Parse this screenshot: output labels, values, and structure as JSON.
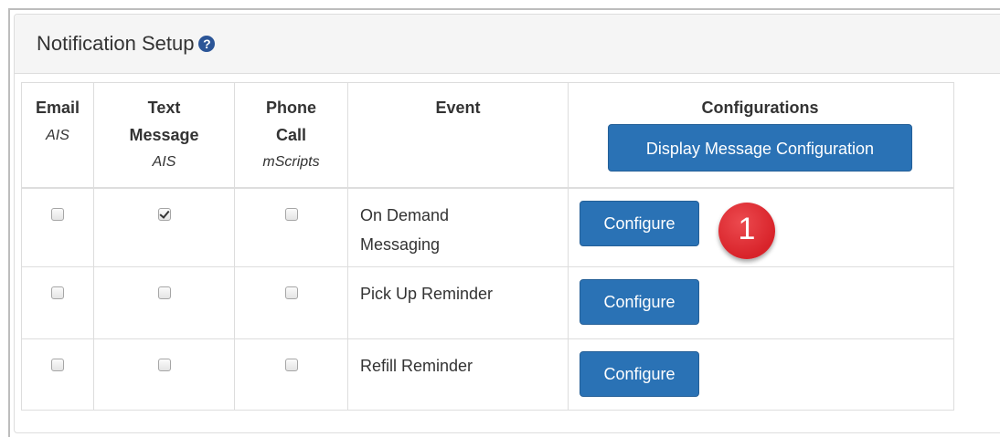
{
  "panel": {
    "title": "Notification Setup",
    "help_icon": "question-circle-icon"
  },
  "table": {
    "columns": [
      {
        "label": "Email",
        "sub": "AIS"
      },
      {
        "label": "Text Message",
        "sub": "AIS"
      },
      {
        "label": "Phone Call",
        "sub": "mScripts"
      },
      {
        "label": "Event",
        "sub": ""
      },
      {
        "label": "Configurations",
        "sub": ""
      }
    ],
    "display_button_label": "Display Message Configuration",
    "rows": [
      {
        "event": "On Demand Messaging",
        "email": false,
        "text": true,
        "phone": false,
        "button": "Configure"
      },
      {
        "event": "Pick Up Reminder",
        "email": false,
        "text": false,
        "phone": false,
        "button": "Configure"
      },
      {
        "event": "Refill Reminder",
        "email": false,
        "text": false,
        "phone": false,
        "button": "Configure"
      }
    ]
  },
  "annotation": {
    "marker_number": "1"
  },
  "colors": {
    "button": "#2a72b5",
    "marker": "#d8232a",
    "help_icon": "#2b5597"
  }
}
